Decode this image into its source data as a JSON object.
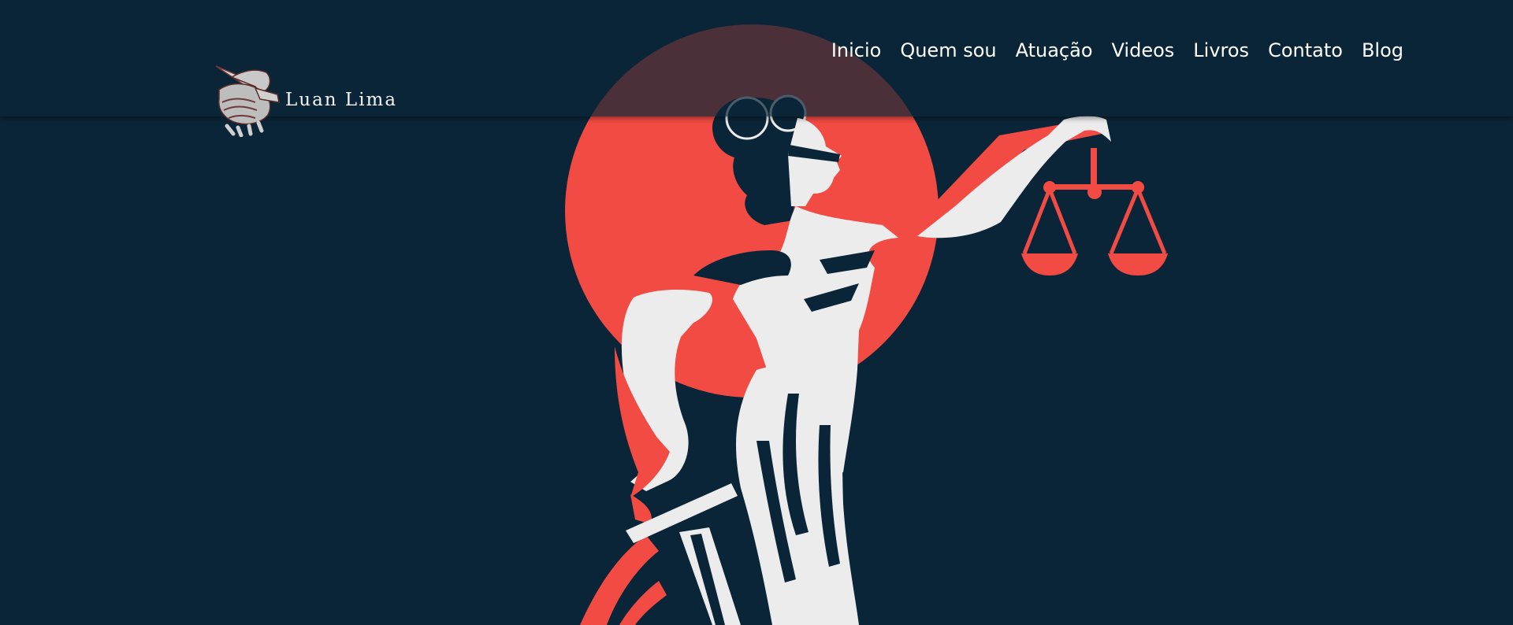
{
  "brand": {
    "name": "Luan Lima",
    "logo_icon": "handshake-icon"
  },
  "nav": {
    "items": [
      {
        "label": "Inicio"
      },
      {
        "label": "Quem sou"
      },
      {
        "label": "Atuação"
      },
      {
        "label": "Videos"
      },
      {
        "label": "Livros"
      },
      {
        "label": "Contato"
      },
      {
        "label": "Blog"
      }
    ]
  },
  "hero": {
    "illustration": "lady-justice-with-scales",
    "colors": {
      "background": "#0a2538",
      "accent": "#f24b43",
      "figure": "#ececec"
    }
  }
}
